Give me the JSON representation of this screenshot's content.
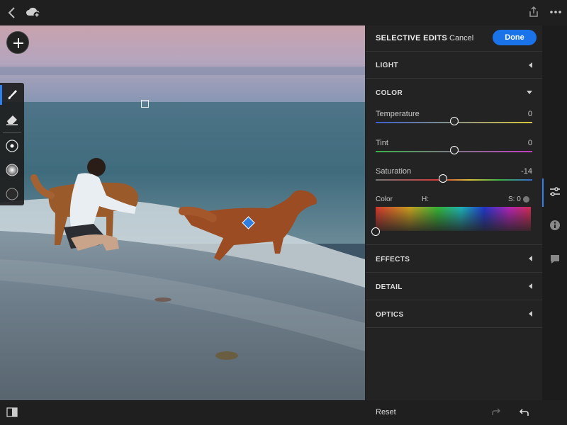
{
  "panel": {
    "title": "SELECTIVE EDITS",
    "cancel_label": "Cancel",
    "done_label": "Done"
  },
  "sections": {
    "light": "LIGHT",
    "color": "COLOR",
    "effects": "EFFECTS",
    "detail": "DETAIL",
    "optics": "OPTICS"
  },
  "color": {
    "temperature": {
      "label": "Temperature",
      "value": "0",
      "position": 0.5
    },
    "tint": {
      "label": "Tint",
      "value": "0",
      "position": 0.5
    },
    "saturation": {
      "label": "Saturation",
      "value": "-14",
      "position": 0.43
    },
    "color_label": "Color",
    "h_label": "H:",
    "s_label": "S: 0"
  },
  "bottom": {
    "reset_label": "Reset"
  },
  "icons": {
    "back": "chevron-left-icon",
    "cloud": "cloud-add-icon",
    "share": "share-icon",
    "more": "more-icon",
    "add": "plus-icon",
    "brush": "brush-icon",
    "eraser": "eraser-icon",
    "compare": "compare-icon",
    "undo": "undo-icon",
    "redo": "redo-icon",
    "edit": "sliders-icon",
    "info": "info-icon",
    "comment": "comment-icon"
  },
  "colors": {
    "accent": "#1a73e8",
    "panel_bg": "#232323"
  }
}
